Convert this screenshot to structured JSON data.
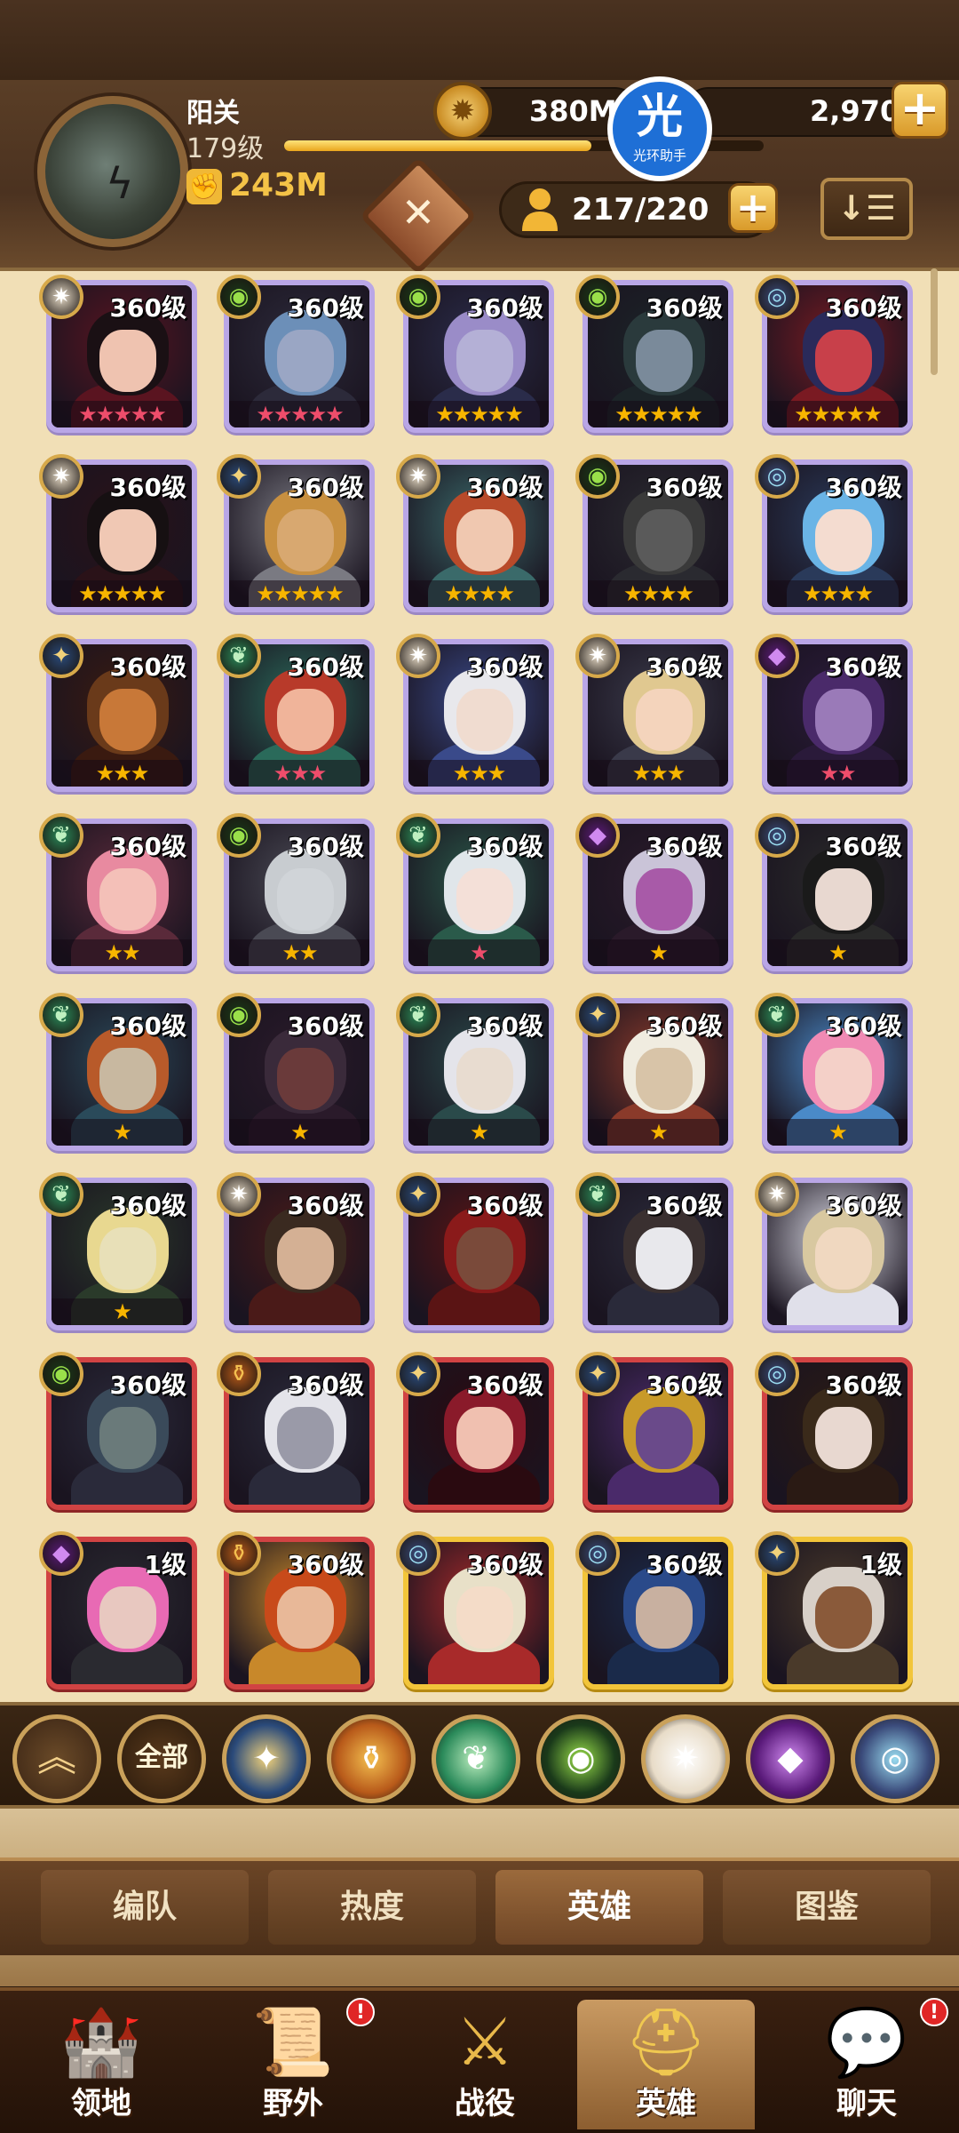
{
  "player": {
    "name": "阳关",
    "level": "179级",
    "power": "243M",
    "xp_fraction": 0.64
  },
  "currency": {
    "gold": "380M",
    "gems": "2,970"
  },
  "watermark": {
    "glyph": "光",
    "text": "光环助手"
  },
  "hero_count": "217/220",
  "sort_icon": "↓☰",
  "colors": {
    "purple_border": "#b9a6e6",
    "red_border": "#d14343",
    "gold_border": "#f2c53a",
    "star_gold": "#f7b500",
    "star_red": "#ee4d6b",
    "accent": "#f4c347"
  },
  "heroes": [
    {
      "level": "360级",
      "frame": "purple",
      "faction": "celestial",
      "stars": "★★★★★",
      "star_color": "red",
      "skin": "#efc3b0",
      "hair": "#1a1014",
      "cloth": "#5a1420"
    },
    {
      "level": "360级",
      "frame": "purple",
      "faction": "graveborn",
      "stars": "★★★★★",
      "star_color": "red",
      "skin": "#9aa6c4",
      "hair": "#6c8fb8",
      "cloth": "#2c2a3a"
    },
    {
      "level": "360级",
      "frame": "purple",
      "faction": "graveborn",
      "stars": "★★★★★",
      "star_color": "gold",
      "skin": "#b4b0d6",
      "hair": "#9a8cc8",
      "cloth": "#2a2c4a"
    },
    {
      "level": "360级",
      "frame": "purple",
      "faction": "graveborn",
      "stars": "★★★★★",
      "star_color": "gold",
      "skin": "#7a8a9a",
      "hair": "#2a3a3c",
      "cloth": "#1c2428"
    },
    {
      "level": "360级",
      "frame": "purple",
      "faction": "dimensional",
      "stars": "★★★★★",
      "star_color": "gold",
      "skin": "#c8404a",
      "hair": "#2a2a5a",
      "cloth": "#7a1a22"
    },
    {
      "level": "360级",
      "frame": "purple",
      "faction": "celestial",
      "stars": "★★★★★",
      "star_color": "gold",
      "skin": "#f0c8b4",
      "hair": "#161012",
      "cloth": "#2a1218"
    },
    {
      "level": "360级",
      "frame": "purple",
      "faction": "lightbearer",
      "stars": "★★★★★",
      "star_color": "gold",
      "skin": "#d8a870",
      "hair": "#c89040",
      "cloth": "#7a7a82"
    },
    {
      "level": "360级",
      "frame": "purple",
      "faction": "celestial",
      "stars": "★★★★",
      "star_color": "gold",
      "skin": "#f0c8b0",
      "hair": "#b84a2a",
      "cloth": "#3a6a6a"
    },
    {
      "level": "360级",
      "frame": "purple",
      "faction": "graveborn",
      "stars": "★★★★",
      "star_color": "gold",
      "skin": "#5a5a5a",
      "hair": "#3a3a3a",
      "cloth": "#2a2a30"
    },
    {
      "level": "360级",
      "frame": "purple",
      "faction": "dimensional",
      "stars": "★★★★",
      "star_color": "gold",
      "skin": "#f4dcd0",
      "hair": "#6ab4e6",
      "cloth": "#2a3a5a"
    },
    {
      "level": "360级",
      "frame": "purple",
      "faction": "lightbearer",
      "stars": "★★★",
      "star_color": "gold",
      "skin": "#c87838",
      "hair": "#6a3a1a",
      "cloth": "#3a1a10"
    },
    {
      "level": "360级",
      "frame": "purple",
      "faction": "wilder",
      "stars": "★★★",
      "star_color": "red",
      "skin": "#f0b49a",
      "hair": "#b83a2a",
      "cloth": "#2a6a5a"
    },
    {
      "level": "360级",
      "frame": "purple",
      "faction": "celestial",
      "stars": "★★★",
      "star_color": "gold",
      "skin": "#f0dcd0",
      "hair": "#e8e8ec",
      "cloth": "#3a4a8a"
    },
    {
      "level": "360级",
      "frame": "purple",
      "faction": "celestial",
      "stars": "★★★",
      "star_color": "gold",
      "skin": "#f4d4bc",
      "hair": "#e0c890",
      "cloth": "#3a3a4a"
    },
    {
      "level": "360级",
      "frame": "purple",
      "faction": "hypogean",
      "stars": "★★",
      "star_color": "red",
      "skin": "#9a7ab8",
      "hair": "#4a2a6a",
      "cloth": "#2a1a3a"
    },
    {
      "level": "360级",
      "frame": "purple",
      "faction": "wilder",
      "stars": "★★",
      "star_color": "gold",
      "skin": "#f4c0b8",
      "hair": "#e88aa0",
      "cloth": "#5a2a3a"
    },
    {
      "level": "360级",
      "frame": "purple",
      "faction": "graveborn",
      "stars": "★★",
      "star_color": "gold",
      "skin": "#d0d4d8",
      "hair": "#c8ccd0",
      "cloth": "#4a4a54"
    },
    {
      "level": "360级",
      "frame": "purple",
      "faction": "wilder",
      "stars": "★",
      "star_color": "red",
      "skin": "#f4e0d8",
      "hair": "#e0e6ea",
      "cloth": "#2a5a4a"
    },
    {
      "level": "360级",
      "frame": "purple",
      "faction": "hypogean",
      "stars": "★",
      "star_color": "gold",
      "skin": "#a85aa8",
      "hair": "#cac4d8",
      "cloth": "#2a1a2a"
    },
    {
      "level": "360级",
      "frame": "purple",
      "faction": "dimensional",
      "stars": "★",
      "star_color": "gold",
      "skin": "#e8d8d0",
      "hair": "#1a1a1a",
      "cloth": "#2a2a2a"
    },
    {
      "level": "360级",
      "frame": "purple",
      "faction": "wilder",
      "stars": "★",
      "star_color": "gold",
      "skin": "#c8b8a0",
      "hair": "#b85a2a",
      "cloth": "#2a4a5a"
    },
    {
      "level": "360级",
      "frame": "purple",
      "faction": "graveborn",
      "stars": "★",
      "star_color": "gold",
      "skin": "#6a3a3a",
      "hair": "#3a2a3a",
      "cloth": "#2a1a2a"
    },
    {
      "level": "360级",
      "frame": "purple",
      "faction": "wilder",
      "stars": "★",
      "star_color": "gold",
      "skin": "#e8dcd0",
      "hair": "#e4e4ea",
      "cloth": "#2a4a4a"
    },
    {
      "level": "360级",
      "frame": "purple",
      "faction": "lightbearer",
      "stars": "★",
      "star_color": "gold",
      "skin": "#d8c4a8",
      "hair": "#f0ece0",
      "cloth": "#8a3a2a"
    },
    {
      "level": "360级",
      "frame": "purple",
      "faction": "wilder",
      "stars": "★",
      "star_color": "gold",
      "skin": "#f4d0c8",
      "hair": "#f08ab4",
      "cloth": "#4a8ac8"
    },
    {
      "level": "360级",
      "frame": "purple",
      "faction": "wilder",
      "stars": "★",
      "star_color": "gold",
      "skin": "#e8e0b8",
      "hair": "#e8d890",
      "cloth": "#2a3a2a"
    },
    {
      "level": "360级",
      "frame": "purple",
      "faction": "celestial",
      "stars": "",
      "star_color": "gold",
      "skin": "#d4b094",
      "hair": "#3a2a20",
      "cloth": "#4a1a18"
    },
    {
      "level": "360级",
      "frame": "purple",
      "faction": "lightbearer",
      "stars": "",
      "star_color": "gold",
      "skin": "#7a4a3a",
      "hair": "#8a1a1a",
      "cloth": "#5a1414"
    },
    {
      "level": "360级",
      "frame": "purple",
      "faction": "wilder",
      "stars": "",
      "star_color": "gold",
      "skin": "#e8e8ec",
      "hair": "#3a3030",
      "cloth": "#2a2a3a"
    },
    {
      "level": "360级",
      "frame": "purple",
      "faction": "celestial",
      "stars": "",
      "star_color": "gold",
      "skin": "#f0d8c0",
      "hair": "#d8c8a0",
      "cloth": "#e0e0ea"
    },
    {
      "level": "360级",
      "frame": "red",
      "faction": "graveborn",
      "stars": "",
      "star_color": "gold",
      "skin": "#6a7a7a",
      "hair": "#3a4a5a",
      "cloth": "#2a2a3a"
    },
    {
      "level": "360级",
      "frame": "red",
      "faction": "mauler",
      "stars": "",
      "star_color": "gold",
      "skin": "#9a9aa8",
      "hair": "#e4e4ea",
      "cloth": "#2a2a3a"
    },
    {
      "level": "360级",
      "frame": "red",
      "faction": "lightbearer",
      "stars": "",
      "star_color": "gold",
      "skin": "#f0c0b0",
      "hair": "#8a1a2a",
      "cloth": "#2a0a10"
    },
    {
      "level": "360级",
      "frame": "red",
      "faction": "lightbearer",
      "stars": "",
      "star_color": "gold",
      "skin": "#6a4a8a",
      "hair": "#c89a2a",
      "cloth": "#4a2a6a"
    },
    {
      "level": "360级",
      "frame": "red",
      "faction": "dimensional",
      "stars": "",
      "star_color": "gold",
      "skin": "#e8d8d0",
      "hair": "#3a2a1a",
      "cloth": "#2a1a14"
    },
    {
      "level": "1级",
      "frame": "red",
      "faction": "hypogean",
      "stars": "",
      "star_color": "gold",
      "skin": "#e8c8c0",
      "hair": "#e86ab4",
      "cloth": "#2a2a30"
    },
    {
      "level": "360级",
      "frame": "red",
      "faction": "mauler",
      "stars": "",
      "star_color": "gold",
      "skin": "#e8b898",
      "hair": "#c84a1a",
      "cloth": "#c8882a"
    },
    {
      "level": "360级",
      "frame": "gold",
      "faction": "dimensional",
      "stars": "",
      "star_color": "gold",
      "skin": "#f4dcc8",
      "hair": "#e8e0c8",
      "cloth": "#a82a2a"
    },
    {
      "level": "360级",
      "frame": "gold",
      "faction": "dimensional",
      "stars": "",
      "star_color": "gold",
      "skin": "#c8b0a0",
      "hair": "#2a4a8a",
      "cloth": "#1a2a4a"
    },
    {
      "level": "1级",
      "frame": "gold",
      "faction": "lightbearer",
      "stars": "",
      "star_color": "gold",
      "skin": "#8a5a3a",
      "hair": "#d8d0c8",
      "cloth": "#4a3a2a"
    }
  ],
  "faction_filters": [
    {
      "name": "collapse",
      "label": "︽"
    },
    {
      "name": "all",
      "label": "全部"
    },
    {
      "name": "lightbearer",
      "label": "✦"
    },
    {
      "name": "mauler",
      "label": "⚱"
    },
    {
      "name": "wilder",
      "label": "❦"
    },
    {
      "name": "graveborn",
      "label": "◉"
    },
    {
      "name": "celestial",
      "label": "✷"
    },
    {
      "name": "hypogean",
      "label": "◆"
    },
    {
      "name": "dimensional",
      "label": "◎"
    }
  ],
  "tabs": [
    {
      "label": "编队",
      "active": false
    },
    {
      "label": "热度",
      "active": false
    },
    {
      "label": "英雄",
      "active": true
    },
    {
      "label": "图鉴",
      "active": false
    }
  ],
  "nav": [
    {
      "label": "领地",
      "icon": "castle-icon",
      "glyph": "🏰",
      "badge": ""
    },
    {
      "label": "野外",
      "icon": "scroll-map-icon",
      "glyph": "📜",
      "badge": "!"
    },
    {
      "label": "战役",
      "icon": "sword-shield-icon",
      "glyph": "⚔",
      "badge": ""
    },
    {
      "label": "英雄",
      "icon": "helmet-icon",
      "glyph": "⛑",
      "badge": ""
    },
    {
      "label": "聊天",
      "icon": "chat-bubble-icon",
      "glyph": "💬",
      "badge": "!"
    }
  ]
}
